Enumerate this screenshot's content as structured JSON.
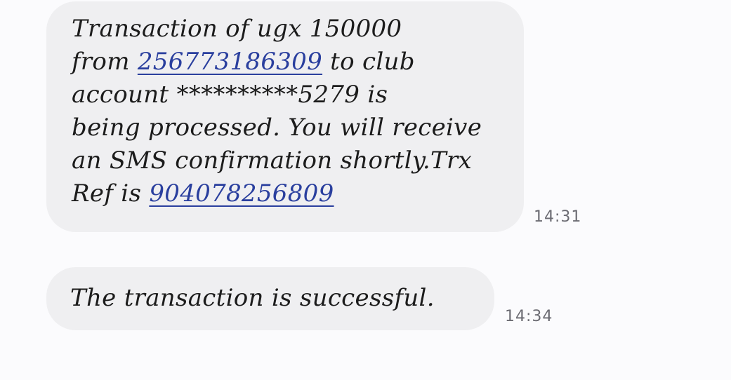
{
  "messages": [
    {
      "line1": "Transaction of ugx 150000",
      "line2_prefix": "from ",
      "phone_link": "256773186309",
      "line2_suffix": " to club",
      "line3": "account **********5279 is",
      "line4": "being processed. You will receive",
      "line5": "an SMS confirmation shortly.Trx",
      "line6_prefix": "Ref is ",
      "ref_link": "904078256809",
      "time": "14:31"
    },
    {
      "text": "The transaction is successful.",
      "time": "14:34"
    }
  ]
}
